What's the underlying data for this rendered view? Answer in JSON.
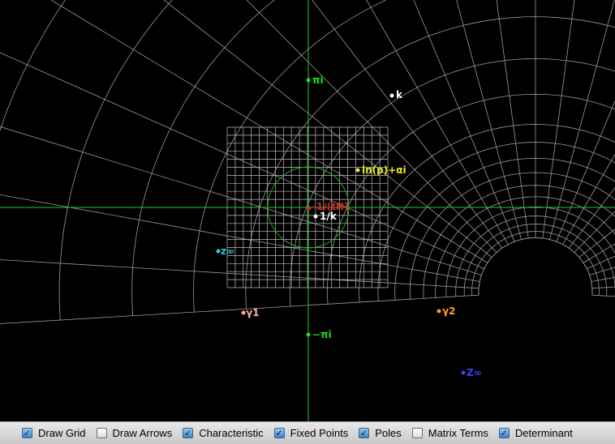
{
  "canvas": {
    "points": [
      {
        "label": "πi",
        "color": "#22dd22"
      },
      {
        "label": "k",
        "color": "#ffffff"
      },
      {
        "label": "ln(p)+αi",
        "color": "#e8e820"
      },
      {
        "label": "-1/(tH)",
        "color": "#dd2222"
      },
      {
        "label": "1/k",
        "color": "#ffffff"
      },
      {
        "label": "z∞",
        "color": "#33cccc"
      },
      {
        "label": "γ1",
        "color": "#ffb0a0"
      },
      {
        "label": "γ2",
        "color": "#ffa020"
      },
      {
        "label": "−πi",
        "color": "#22dd22"
      },
      {
        "label": "Z∞",
        "color": "#3344ff"
      }
    ]
  },
  "toolbar": {
    "options": [
      {
        "label": "Draw Grid",
        "checked": true
      },
      {
        "label": "Draw Arrows",
        "checked": false
      },
      {
        "label": "Characteristic",
        "checked": true
      },
      {
        "label": "Fixed Points",
        "checked": true
      },
      {
        "label": "Poles",
        "checked": true
      },
      {
        "label": "Matrix Terms",
        "checked": false
      },
      {
        "label": "Determinant",
        "checked": true
      }
    ]
  }
}
